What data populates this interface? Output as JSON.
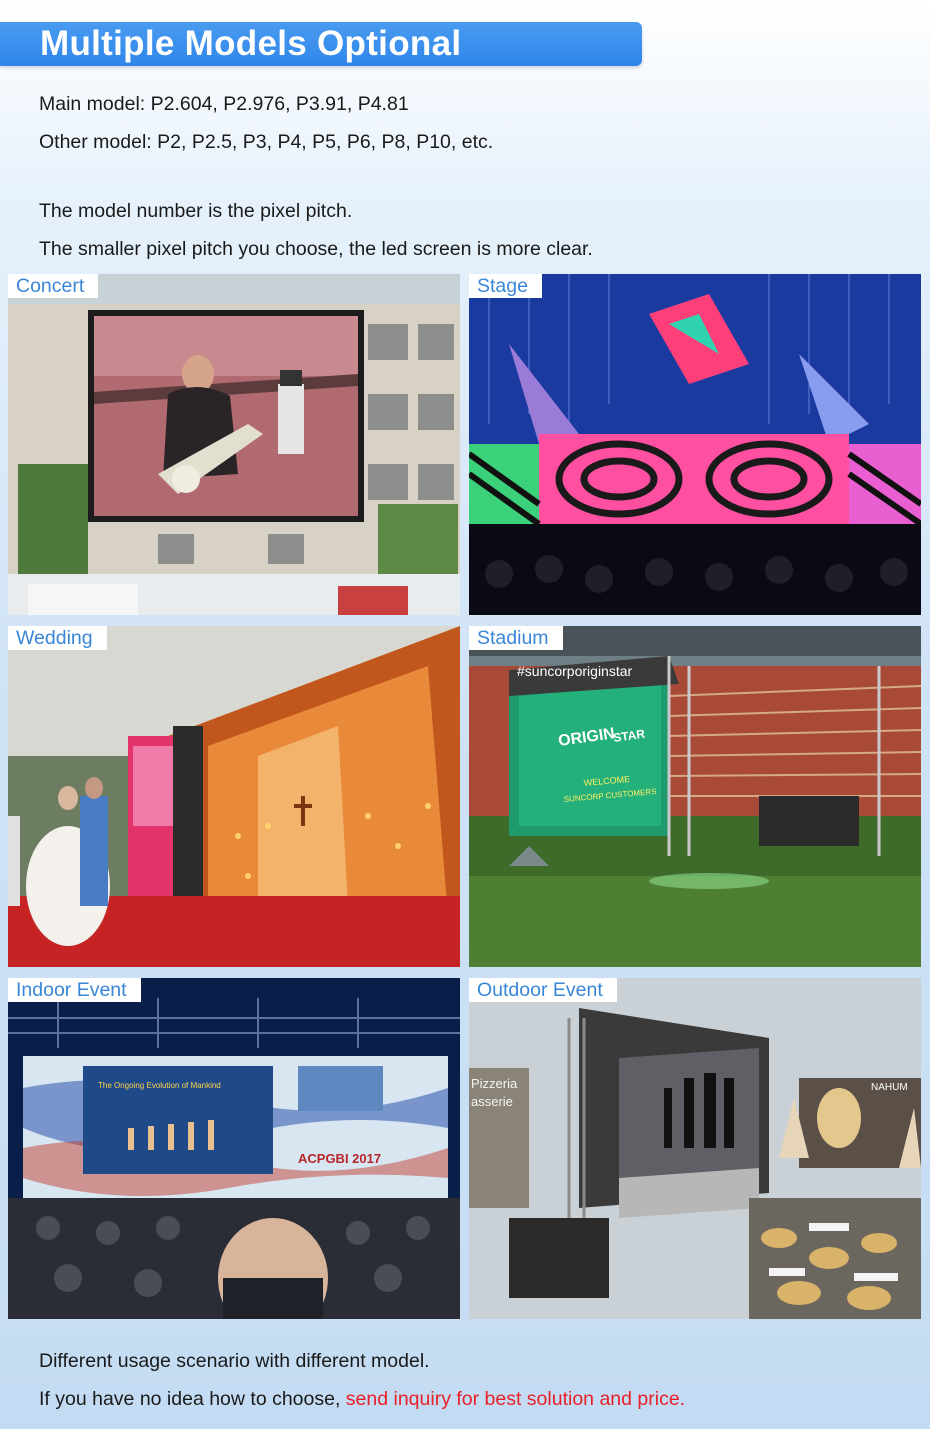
{
  "header": {
    "title": "Multiple Models Optional"
  },
  "intro": {
    "main_model": "Main model: P2.604, P2.976, P3.91, P4.81",
    "other_model": "Other model: P2, P2.5, P3, P4, P5, P6, P8, P10, etc.",
    "pitch_note": "The model number is the pixel pitch.",
    "clarity_note": "The smaller pixel pitch you choose, the led screen is more clear."
  },
  "scenarios": {
    "concert": "Concert",
    "stage": "Stage",
    "wedding": "Wedding",
    "stadium": "Stadium",
    "indoor_event": "Indoor Event",
    "outdoor_event": "Outdoor Event"
  },
  "screen_texts": {
    "stadium_hashtag": "#suncorporiginstar",
    "stadium_logo_1": "ORIGIN",
    "stadium_logo_2": "STAR",
    "stadium_welcome_1": "WELCOME",
    "stadium_welcome_2": "SUNCORP CUSTOMERS",
    "indoor_slide_title": "The Ongoing Evolution of Mankind",
    "indoor_logo": "ACPGBI 2017",
    "outdoor_sign_1": "Pizzeria",
    "outdoor_sign_2": "asserie",
    "outdoor_sign_3": "NAHUM"
  },
  "footer": {
    "line1": "Different usage scenario with different model.",
    "line2_prefix": "If you have no idea how to choose, ",
    "line2_link": "send inquiry for best solution and price."
  },
  "colors": {
    "banner": "#2f86ea",
    "label_text": "#3a86d6",
    "link_red": "#e8202a"
  }
}
